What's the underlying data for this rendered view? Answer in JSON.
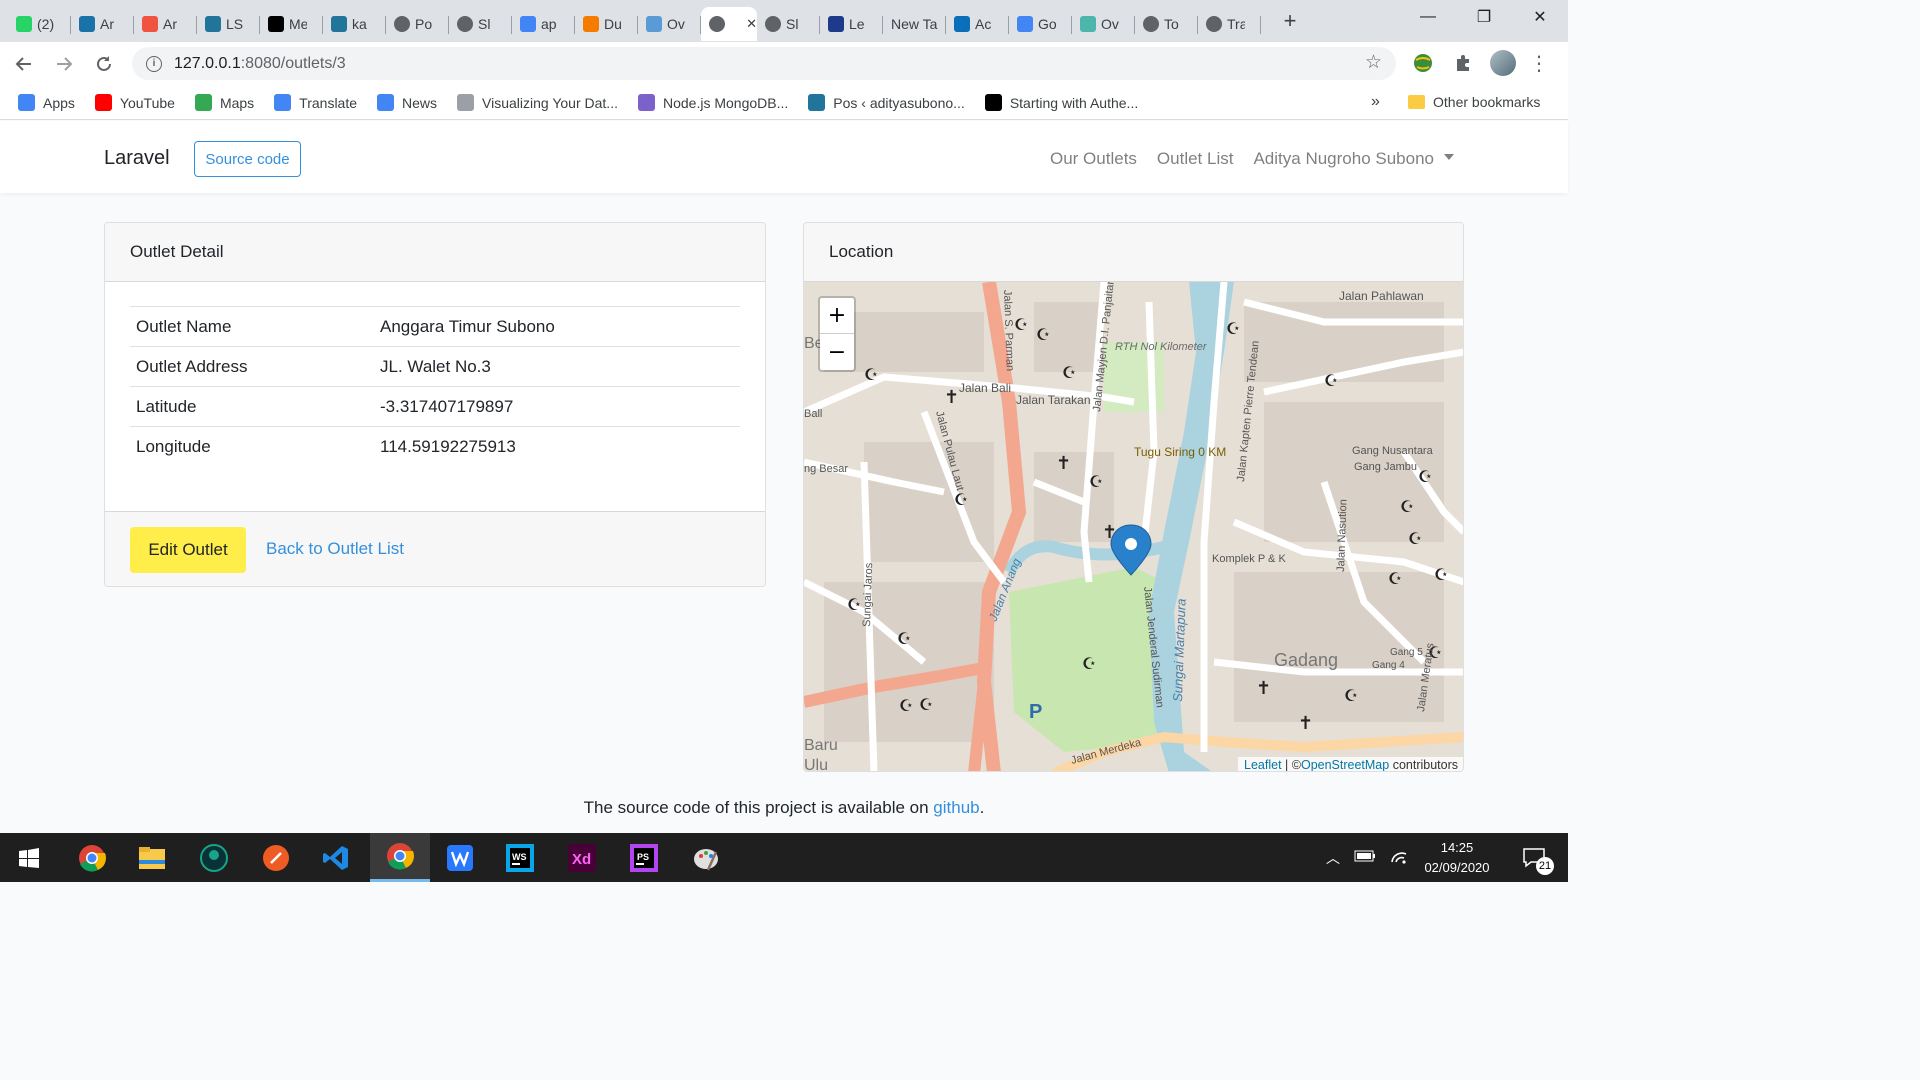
{
  "tabs": [
    {
      "title": "(2)",
      "icon": "whatsapp-icon",
      "color": "#25d366"
    },
    {
      "title": "Ar",
      "icon": "bird-icon",
      "color": "#1a73a8"
    },
    {
      "title": "Ar",
      "icon": "laravel-icon",
      "color": "#f05340"
    },
    {
      "title": "LS",
      "icon": "wordpress-icon",
      "color": "#21759b"
    },
    {
      "title": "Me",
      "icon": "medium-icon",
      "color": "#000000"
    },
    {
      "title": "ka",
      "icon": "wordpress-icon",
      "color": "#21759b"
    },
    {
      "title": "Po",
      "icon": "globe-icon",
      "color": "#5f6368"
    },
    {
      "title": "Sl",
      "icon": "globe-icon",
      "color": "#5f6368"
    },
    {
      "title": "ap",
      "icon": "google-icon",
      "color": "#4285f4"
    },
    {
      "title": "Du",
      "icon": "jh-icon",
      "color": "#f57c00"
    },
    {
      "title": "Ov",
      "icon": "grid-icon",
      "color": "#5b9bd5"
    },
    {
      "title": "",
      "icon": "globe-icon",
      "color": "#5f6368",
      "active": true
    },
    {
      "title": "Sl",
      "icon": "globe-icon",
      "color": "#5f6368"
    },
    {
      "title": "Le",
      "icon": "ambassador-icon",
      "color": "#1e3a8a"
    },
    {
      "title": "New Ta",
      "icon": "",
      "color": ""
    },
    {
      "title": "Ac",
      "icon": "webstorm-icon",
      "color": "#0a6fb8"
    },
    {
      "title": "Go",
      "icon": "translate-icon",
      "color": "#4285f4"
    },
    {
      "title": "Ov",
      "icon": "openapi-icon",
      "color": "#4db6ac"
    },
    {
      "title": "To",
      "icon": "globe-icon",
      "color": "#5f6368"
    },
    {
      "title": "Tra",
      "icon": "globe-icon",
      "color": "#5f6368"
    }
  ],
  "browser": {
    "url_host": "127.0.0.1",
    "url_path": ":8080/outlets/3",
    "new_tab_label": "+",
    "close_tab_label": "✕",
    "minimize_label": "—",
    "restore_label": "❐",
    "close_label": "✕"
  },
  "bookmarks": [
    {
      "label": "Apps",
      "icon": "apps-icon",
      "color": "#4285f4"
    },
    {
      "label": "YouTube",
      "icon": "youtube-icon",
      "color": "#ff0000"
    },
    {
      "label": "Maps",
      "icon": "maps-icon",
      "color": "#34a853"
    },
    {
      "label": "Translate",
      "icon": "translate-icon",
      "color": "#4285f4"
    },
    {
      "label": "News",
      "icon": "news-icon",
      "color": "#4285f4"
    },
    {
      "label": "Visualizing Your Dat...",
      "icon": "gear-globe-icon",
      "color": "#9aa0a6"
    },
    {
      "label": "Node.js MongoDB...",
      "icon": "grid-icon",
      "color": "#7b61c9"
    },
    {
      "label": "Pos ‹ adityasubono...",
      "icon": "wordpress-icon",
      "color": "#21759b"
    },
    {
      "label": "Starting with Authe...",
      "icon": "medium-icon",
      "color": "#000000"
    }
  ],
  "bookmarks_overflow": "»",
  "other_bookmarks": "Other bookmarks",
  "navbar": {
    "brand": "Laravel",
    "source_button": "Source code",
    "links": [
      "Our Outlets",
      "Outlet List"
    ],
    "user": "Aditya Nugroho Subono"
  },
  "detail": {
    "header": "Outlet Detail",
    "rows": [
      {
        "label": "Outlet Name",
        "value": "Anggara Timur Subono"
      },
      {
        "label": "Outlet Address",
        "value": "JL. Walet No.3"
      },
      {
        "label": "Latitude",
        "value": "-3.317407179897"
      },
      {
        "label": "Longitude",
        "value": "114.59192275913"
      }
    ],
    "edit_button": "Edit Outlet",
    "back_link": "Back to Outlet List"
  },
  "location": {
    "header": "Location",
    "zoom_in": "+",
    "zoom_out": "−",
    "map_labels": [
      "Besar",
      "Jalan S. Parman",
      "RTH Nol Kilometer",
      "Jalan Mayjen D.I. Panjaitan",
      "Jalan Bali",
      "Jalan Tarakan",
      "Jalan Pulau Laut",
      "Tugu Siring 0 KM",
      "Jalan Kapten Pierre Tendean",
      "Jalan Pahlawan",
      "Gang Nusantara",
      "Gang Jambu",
      "Jalan Nasution",
      "Komplek P & K",
      "Sungai Martapura",
      "Jalan Jenderal Sudirman",
      "Gadang",
      "Gang 5",
      "Gang 4",
      "Jalan Meratus",
      "Sungai Jaros",
      "Jalan Merdeka",
      "Jalan Anang",
      "Baru",
      "Ulu",
      "ng Besar",
      "Ball"
    ],
    "attribution_leaflet": "Leaflet",
    "attribution_sep": " | ©",
    "attribution_osm": "OpenStreetMap",
    "attribution_tail": " contributors"
  },
  "footer": {
    "text": "The source code of this project is available on ",
    "link": "github",
    "end": "."
  },
  "taskbar": {
    "apps": [
      "start-icon",
      "chrome-icon",
      "file-explorer-icon",
      "gitkraken-icon",
      "postman-icon",
      "vscode-icon",
      "chrome-active-icon",
      "wps-icon",
      "webstorm-icon",
      "xd-icon",
      "phpstorm-icon",
      "paint-icon"
    ],
    "time": "14:25",
    "date": "02/09/2020",
    "notifications": "21"
  }
}
